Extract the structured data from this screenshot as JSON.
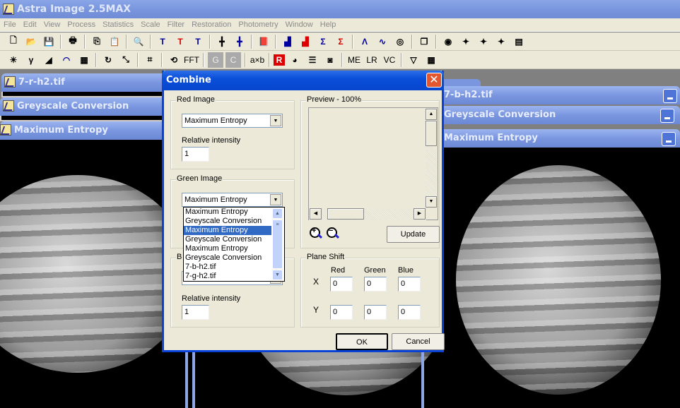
{
  "app": {
    "title": "Astra Image 2.5MAX"
  },
  "menu": [
    "File",
    "Edit",
    "View",
    "Process",
    "Statistics",
    "Scale",
    "Filter",
    "Restoration",
    "Photometry",
    "Window",
    "Help"
  ],
  "toolbar1": [
    "new",
    "open",
    "save",
    "|",
    "print",
    "|",
    "copy",
    "paste",
    "|",
    "zoom",
    "|",
    "text-T-cursor",
    "text-T-red",
    "text-T-delete",
    "|",
    "crosshair-1",
    "crosshair-delete",
    "|",
    "book",
    "|",
    "histogram",
    "histogram-red",
    "sigma",
    "sigma-red",
    "|",
    "peak",
    "wave",
    "spiral",
    "|",
    "layers",
    "|",
    "target",
    "star-c",
    "star",
    "star-add",
    "info"
  ],
  "toolbar2": [
    "brightness",
    "gamma",
    "curve-linear",
    "curve-histogram",
    "film",
    "|",
    "rotate",
    "resize",
    "|",
    "crop",
    "|",
    "transform",
    "fft",
    "|",
    "G",
    "C",
    "|",
    "a×b",
    "|",
    "R",
    "color-wheel",
    "rgb-bars",
    "heatmap",
    "|",
    "ME",
    "LR",
    "VC",
    "|",
    "filter",
    "grid"
  ],
  "toolbar2_text": {
    "fft": "FFT",
    "G": "G",
    "C": "C",
    "axb": "a×b",
    "me": "ME",
    "lr": "LR",
    "vc": "VC"
  },
  "windows_left": [
    "7-r-h2.tif",
    "Greyscale Conversion",
    "Maximum Entropy"
  ],
  "windows_right": [
    "7-b-h2.tif",
    "Greyscale Conversion",
    "Maximum Entropy"
  ],
  "dialog": {
    "title": "Combine",
    "red": {
      "legend": "Red Image",
      "selected": "Maximum Entropy",
      "intensity_label": "Relative intensity",
      "intensity": "1"
    },
    "green": {
      "legend": "Green Image",
      "selected": "Maximum Entropy"
    },
    "blue": {
      "legend": "B",
      "intensity_label": "Relative intensity",
      "intensity": "1"
    },
    "dropdown_items": [
      "Maximum Entropy",
      "Greyscale Conversion",
      "Maximum Entropy",
      "Greyscale Conversion",
      "Maximum Entropy",
      "Greyscale Conversion",
      "7-b-h2.tif",
      "7-g-h2.tif"
    ],
    "dropdown_highlighted": 2,
    "preview": {
      "legend": "Preview - 100%",
      "update": "Update"
    },
    "plane_shift": {
      "legend": "Plane Shift",
      "cols": [
        "Red",
        "Green",
        "Blue"
      ],
      "rows": [
        "X",
        "Y"
      ],
      "x": [
        "0",
        "0",
        "0"
      ],
      "y": [
        "0",
        "0",
        "0"
      ]
    },
    "ok": "OK",
    "cancel": "Cancel"
  },
  "colors": {
    "dialog_title": "#0a4fd8",
    "selection": "#316ac5",
    "window_title": "#7a96df"
  }
}
